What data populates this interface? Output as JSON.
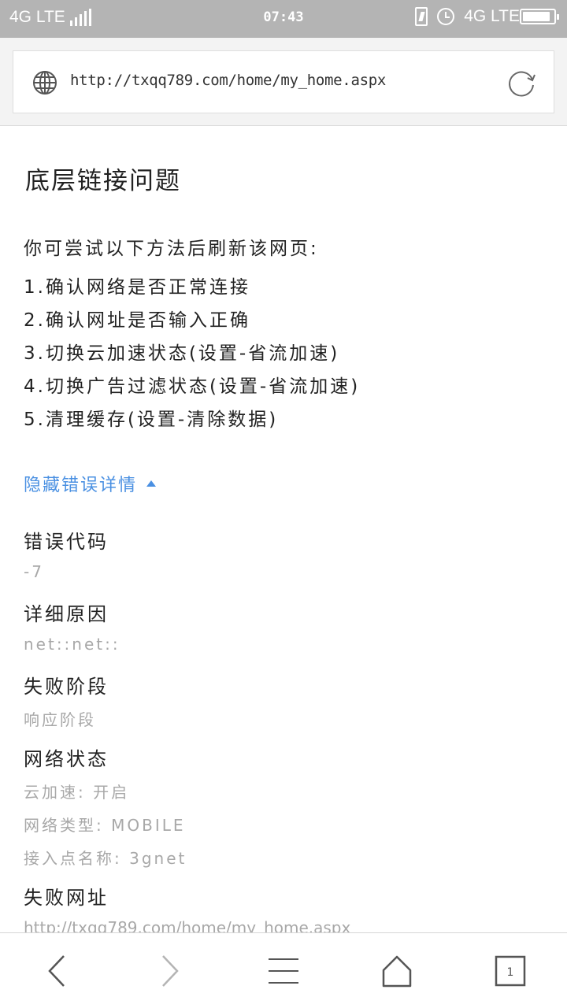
{
  "status_bar": {
    "network_left": "4G LTE",
    "time": "07:43",
    "network_right": "4G LTE",
    "battery_level": 0.9
  },
  "url_bar": {
    "url": "http://txqq789.com/home/my_home.aspx"
  },
  "error_page": {
    "title": "底层链接问题",
    "intro": "你可尝试以下方法后刷新该网页:",
    "tips": [
      "1.确认网络是否正常连接",
      "2.确认网址是否输入正确",
      "3.切换云加速状态(设置-省流加速)",
      "4.切换广告过滤状态(设置-省流加速)",
      "5.清理缓存(设置-清除数据)"
    ],
    "toggle_label": "隐藏错误详情",
    "details": {
      "error_code_label": "错误代码",
      "error_code_value": "-7",
      "reason_label": "详细原因",
      "reason_value": "net::net::",
      "stage_label": "失败阶段",
      "stage_value": "响应阶段",
      "network_label": "网络状态",
      "network_values": [
        "云加速: 开启",
        "网络类型: MOBILE",
        "接入点名称: 3gnet"
      ],
      "failed_url_label": "失败网址",
      "failed_url_value": "http://txqq789.com/home/my_home.aspx"
    }
  },
  "bottom_nav": {
    "tab_count": "1"
  },
  "colors": {
    "status_bar": "#b4b4b4",
    "link": "#4a90e2",
    "muted_text": "#a8a8a8"
  }
}
